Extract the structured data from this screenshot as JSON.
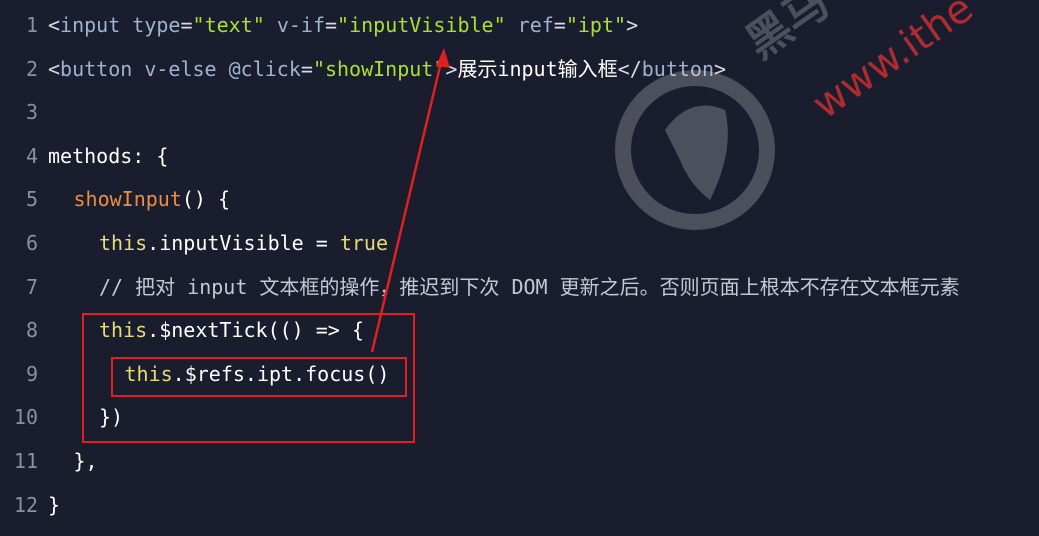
{
  "code": {
    "lines": [
      {
        "num": "1",
        "indent": 0,
        "tokens": [
          {
            "t": "<",
            "c": "punc"
          },
          {
            "t": "input",
            "c": "tag"
          },
          {
            "t": " type",
            "c": "attr"
          },
          {
            "t": "=",
            "c": "punc"
          },
          {
            "t": "\"text\"",
            "c": "str"
          },
          {
            "t": " v-if",
            "c": "attr"
          },
          {
            "t": "=",
            "c": "punc"
          },
          {
            "t": "\"inputVisible\"",
            "c": "str"
          },
          {
            "t": " ref",
            "c": "attr"
          },
          {
            "t": "=",
            "c": "punc"
          },
          {
            "t": "\"ipt\"",
            "c": "str"
          },
          {
            "t": ">",
            "c": "punc"
          }
        ]
      },
      {
        "num": "2",
        "indent": 0,
        "tokens": [
          {
            "t": "<",
            "c": "punc"
          },
          {
            "t": "button",
            "c": "tag"
          },
          {
            "t": " v-else",
            "c": "attr"
          },
          {
            "t": " @click",
            "c": "attr"
          },
          {
            "t": "=",
            "c": "punc"
          },
          {
            "t": "\"showInput\"",
            "c": "str"
          },
          {
            "t": ">",
            "c": "punc"
          },
          {
            "t": "展示input输入框",
            "c": "text"
          },
          {
            "t": "</",
            "c": "punc"
          },
          {
            "t": "button",
            "c": "tag"
          },
          {
            "t": ">",
            "c": "punc"
          }
        ]
      },
      {
        "num": "3",
        "indent": 0,
        "tokens": []
      },
      {
        "num": "4",
        "indent": 0,
        "tokens": [
          {
            "t": "methods: {",
            "c": "plain"
          }
        ]
      },
      {
        "num": "5",
        "indent": 1,
        "tokens": [
          {
            "t": "showInput",
            "c": "fn"
          },
          {
            "t": "() {",
            "c": "plain"
          }
        ]
      },
      {
        "num": "6",
        "indent": 2,
        "tokens": [
          {
            "t": "this",
            "c": "this"
          },
          {
            "t": ".inputVisible = ",
            "c": "plain"
          },
          {
            "t": "true",
            "c": "kw"
          }
        ]
      },
      {
        "num": "7",
        "indent": 2,
        "tokens": [
          {
            "t": "// 把对 input 文本框的操作，推迟到下次 DOM 更新之后。否则页面上根本不存在文本框元素",
            "c": "comment"
          }
        ]
      },
      {
        "num": "8",
        "indent": 2,
        "tokens": [
          {
            "t": "this",
            "c": "this"
          },
          {
            "t": ".$nextTick(() => {",
            "c": "plain"
          }
        ]
      },
      {
        "num": "9",
        "indent": 3,
        "tokens": [
          {
            "t": "this",
            "c": "this"
          },
          {
            "t": ".$refs.ipt.focus()",
            "c": "plain"
          }
        ]
      },
      {
        "num": "10",
        "indent": 2,
        "tokens": [
          {
            "t": "})",
            "c": "plain"
          }
        ]
      },
      {
        "num": "11",
        "indent": 1,
        "tokens": [
          {
            "t": "},",
            "c": "plain"
          }
        ]
      },
      {
        "num": "12",
        "indent": 0,
        "tokens": [
          {
            "t": "}",
            "c": "plain"
          }
        ]
      }
    ]
  },
  "watermark": {
    "text": "www.ithe",
    "logo_chars": "黑马"
  },
  "colors": {
    "highlight": "#e02020",
    "background": "#1a1d2e"
  }
}
